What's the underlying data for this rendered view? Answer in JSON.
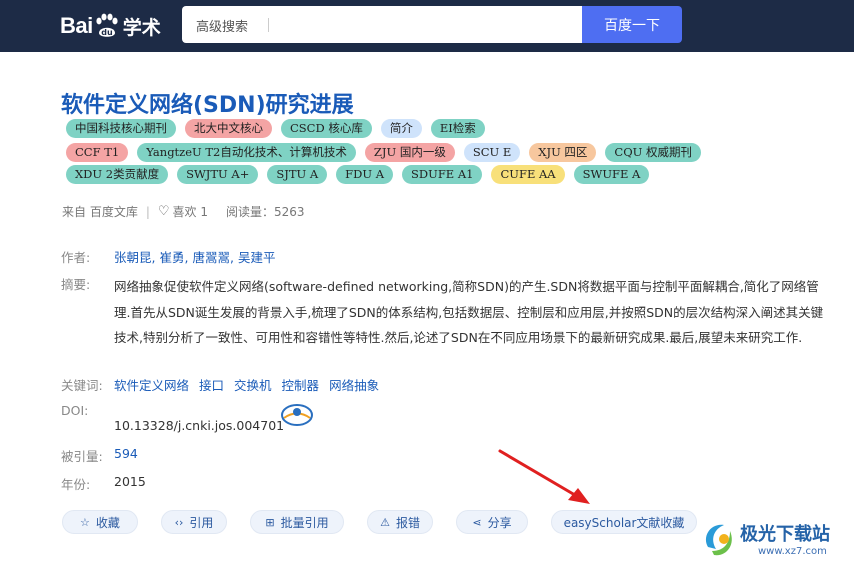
{
  "header": {
    "logo_bai": "Bai",
    "logo_du": "du",
    "logo_xue": "学术",
    "adv_search_label": "高级搜索",
    "search_value": "",
    "search_button": "百度一下"
  },
  "paper": {
    "title": "软件定义网络(SDN)研究进展",
    "tag_rows": [
      [
        {
          "label": "中国科技核心期刊",
          "color": "teal"
        },
        {
          "label": "北大中文核心",
          "color": "pink"
        },
        {
          "label": "CSCD 核心库",
          "color": "teal"
        },
        {
          "label": "简介",
          "color": "lightblue"
        },
        {
          "label": "EI检索",
          "color": "teal"
        }
      ],
      [
        {
          "label": "CCF T1",
          "color": "pink"
        },
        {
          "label": "YangtzeU T2自动化技术、计算机技术",
          "color": "teal"
        },
        {
          "label": "ZJU 国内一级",
          "color": "pink"
        },
        {
          "label": "SCU E",
          "color": "lightblue"
        },
        {
          "label": "XJU 四区",
          "color": "orange"
        },
        {
          "label": "CQU 权威期刊",
          "color": "teal"
        }
      ],
      [
        {
          "label": "XDU 2类贡献度",
          "color": "teal"
        },
        {
          "label": "SWJTU A+",
          "color": "teal"
        },
        {
          "label": "SJTU A",
          "color": "teal"
        },
        {
          "label": "FDU A",
          "color": "teal"
        },
        {
          "label": "SDUFE A1",
          "color": "teal"
        },
        {
          "label": "CUFE AA",
          "color": "yellow"
        },
        {
          "label": "SWUFE A",
          "color": "teal"
        }
      ]
    ],
    "meta": {
      "source": "来自 百度文库",
      "likes": "喜欢 1",
      "reads": "阅读量：5263"
    },
    "authors_label": "作者:",
    "authors": [
      "张朝昆,",
      "崔勇,",
      "唐翯翯,",
      "吴建平"
    ],
    "abstract_label": "摘要:",
    "abstract": "网络抽象促使软件定义网络(software-defined networking,简称SDN)的产生.SDN将数据平面与控制平面解耦合,简化了网络管理.首先从SDN诞生发展的背景入手,梳理了SDN的体系结构,包括数据层、控制层和应用层,并按照SDN的层次结构深入阐述其关键技术,特别分析了一致性、可用性和容错性等特性.然后,论述了SDN在不同应用场景下的最新研究成果.最后,展望未来研究工作.",
    "keywords_label": "关键词:",
    "keywords": [
      "软件定义网络",
      "接口",
      "交换机",
      "控制器",
      "网络抽象"
    ],
    "doi_label": "DOI:",
    "doi": "10.13328/j.cnki.jos.004701",
    "cited_label": "被引量:",
    "cited": "594",
    "year_label": "年份:",
    "year": "2015"
  },
  "actions": [
    {
      "icon": "star-icon",
      "glyph": "☆",
      "label": "收藏",
      "width": 76
    },
    {
      "icon": "code-icon",
      "glyph": "‹›",
      "label": "引用",
      "width": 66
    },
    {
      "icon": "folder-icon",
      "glyph": "⊞",
      "label": "批量引用",
      "width": 94
    },
    {
      "icon": "warning-icon",
      "glyph": "⚠",
      "label": "报错",
      "width": 66
    },
    {
      "icon": "share-icon",
      "glyph": "⋖",
      "label": "分享",
      "width": 72
    },
    {
      "icon": "",
      "glyph": "",
      "label": "easyScholar文献收藏",
      "width": 146
    }
  ],
  "watermark": {
    "text": "极光下载站",
    "url": "www.xz7.com"
  },
  "colors": {
    "header_bg": "#1d2b46",
    "accent": "#4e6ef2",
    "title": "#1a5bb8",
    "arrow": "#e02020"
  }
}
